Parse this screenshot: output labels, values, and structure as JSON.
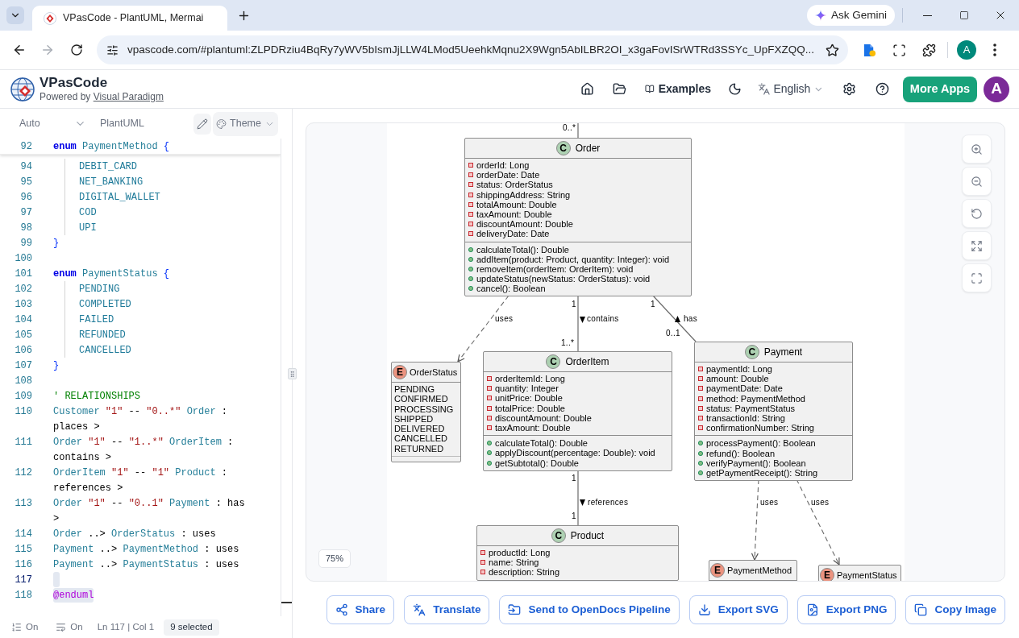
{
  "browser": {
    "tab_title": "VPasCode - PlantUML, Mermai",
    "gemini_button": "Ask Gemini",
    "address": "vpascode.com/#plantuml:ZLPDRziu4BqRy7yWV5bIsmJjLLW4LMod5UeehkMqnu2X9Wgn5AbILBR2OI_x3gaFovISrWTRd3SSYc_UpFXZQQ...",
    "profile_initial": "A"
  },
  "header": {
    "app_name": "VPasCode",
    "tagline": "Powered by",
    "tagline_link": "Visual Paradigm",
    "examples": "Examples",
    "language": "English",
    "more_apps": "More Apps",
    "avatar_initial": "A"
  },
  "editor": {
    "mode": "Auto",
    "language": "PlantUML",
    "theme_button": "Theme",
    "sticky_line": {
      "number": "92",
      "selected": false,
      "active": false,
      "tokens": [
        {
          "kind": "keyword",
          "text": "enum "
        },
        {
          "kind": "name",
          "text": "PaymentMethod "
        },
        {
          "kind": "brace",
          "text": "{"
        }
      ],
      "children": [
        {
          "number": "94",
          "selected": false,
          "active": false,
          "tokens": [
            {
              "kind": "constant",
              "text": "DEBIT_CARD"
            }
          ]
        },
        {
          "number": "95",
          "selected": false,
          "active": false,
          "tokens": [
            {
              "kind": "constant",
              "text": "NET_BANKING"
            }
          ]
        },
        {
          "number": "96",
          "selected": false,
          "active": false,
          "tokens": [
            {
              "kind": "constant",
              "text": "DIGITAL_WALLET"
            }
          ]
        },
        {
          "number": "97",
          "selected": false,
          "active": false,
          "tokens": [
            {
              "kind": "constant",
              "text": "COD"
            }
          ]
        },
        {
          "number": "98",
          "selected": false,
          "active": false,
          "tokens": [
            {
              "kind": "constant",
              "text": "UPI"
            }
          ]
        }
      ]
    },
    "lines": [
      {
        "number": "99",
        "selected": false,
        "active": false,
        "tokens": [
          {
            "kind": "brace",
            "text": "}"
          }
        ]
      },
      {
        "number": "100",
        "selected": false,
        "active": false
      },
      {
        "number": "101",
        "selected": false,
        "active": false,
        "tokens": [
          {
            "kind": "keyword",
            "text": "enum "
          },
          {
            "kind": "name",
            "text": "PaymentStatus "
          },
          {
            "kind": "brace",
            "text": "{"
          }
        ],
        "children": [
          {
            "number": "102",
            "selected": false,
            "active": false,
            "tokens": [
              {
                "kind": "constant",
                "text": "PENDING"
              }
            ]
          },
          {
            "number": "103",
            "selected": false,
            "active": false,
            "tokens": [
              {
                "kind": "constant",
                "text": "COMPLETED"
              }
            ]
          },
          {
            "number": "104",
            "selected": false,
            "active": false,
            "tokens": [
              {
                "kind": "constant",
                "text": "FAILED"
              }
            ]
          },
          {
            "number": "105",
            "selected": false,
            "active": false,
            "tokens": [
              {
                "kind": "constant",
                "text": "REFUNDED"
              }
            ]
          },
          {
            "number": "106",
            "selected": false,
            "active": false,
            "tokens": [
              {
                "kind": "constant",
                "text": "CANCELLED"
              }
            ]
          }
        ]
      },
      {
        "number": "107",
        "selected": false,
        "active": false,
        "tokens": [
          {
            "kind": "brace",
            "text": "}"
          }
        ]
      },
      {
        "number": "108",
        "selected": false,
        "active": false
      },
      {
        "number": "109",
        "selected": false,
        "active": false,
        "tokens": [
          {
            "kind": "comment",
            "text": "' RELATIONSHIPS"
          }
        ]
      },
      {
        "number": "110",
        "selected": false,
        "active": false,
        "tokens": [
          {
            "kind": "name",
            "text": "Customer "
          },
          {
            "kind": "string",
            "text": "\"1\""
          },
          {
            "kind": "plain",
            "text": " -- "
          },
          {
            "kind": "string",
            "text": "\"0..*\""
          },
          {
            "kind": "name",
            "text": " Order"
          },
          {
            "kind": "plain",
            "text": " :"
          }
        ],
        "continuation": [
          {
            "kind": "plain",
            "text": "places >"
          }
        ]
      },
      {
        "number": "111",
        "selected": false,
        "active": false,
        "tokens": [
          {
            "kind": "name",
            "text": "Order "
          },
          {
            "kind": "string",
            "text": "\"1\""
          },
          {
            "kind": "plain",
            "text": " -- "
          },
          {
            "kind": "string",
            "text": "\"1..*\""
          },
          {
            "kind": "name",
            "text": " OrderItem"
          },
          {
            "kind": "plain",
            "text": " :"
          }
        ],
        "continuation": [
          {
            "kind": "plain",
            "text": "contains >"
          }
        ]
      },
      {
        "number": "112",
        "selected": false,
        "active": false,
        "tokens": [
          {
            "kind": "name",
            "text": "OrderItem "
          },
          {
            "kind": "string",
            "text": "\"1\""
          },
          {
            "kind": "plain",
            "text": " -- "
          },
          {
            "kind": "string",
            "text": "\"1\""
          },
          {
            "kind": "name",
            "text": " Product"
          },
          {
            "kind": "plain",
            "text": " :"
          }
        ],
        "continuation": [
          {
            "kind": "plain",
            "text": "references >"
          }
        ]
      },
      {
        "number": "113",
        "selected": false,
        "active": false,
        "tokens": [
          {
            "kind": "name",
            "text": "Order "
          },
          {
            "kind": "string",
            "text": "\"1\""
          },
          {
            "kind": "plain",
            "text": " -- "
          },
          {
            "kind": "string",
            "text": "\"0..1\""
          },
          {
            "kind": "name",
            "text": " Payment"
          },
          {
            "kind": "plain",
            "text": " : has"
          }
        ],
        "continuation": [
          {
            "kind": "plain",
            "text": ">"
          }
        ]
      },
      {
        "number": "114",
        "selected": false,
        "active": false,
        "tokens": [
          {
            "kind": "name",
            "text": "Order"
          },
          {
            "kind": "plain",
            "text": " ..> "
          },
          {
            "kind": "name",
            "text": "OrderStatus"
          },
          {
            "kind": "plain",
            "text": " : uses"
          }
        ]
      },
      {
        "number": "115",
        "selected": false,
        "active": false,
        "tokens": [
          {
            "kind": "name",
            "text": "Payment"
          },
          {
            "kind": "plain",
            "text": " ..> "
          },
          {
            "kind": "name",
            "text": "PaymentMethod"
          },
          {
            "kind": "plain",
            "text": " : uses"
          }
        ]
      },
      {
        "number": "116",
        "selected": false,
        "active": false,
        "tokens": [
          {
            "kind": "name",
            "text": "Payment"
          },
          {
            "kind": "plain",
            "text": " ..> "
          },
          {
            "kind": "name",
            "text": "PaymentStatus"
          },
          {
            "kind": "plain",
            "text": " : uses"
          }
        ]
      },
      {
        "number": "117",
        "selected": true,
        "active": true
      },
      {
        "number": "118",
        "selected": true,
        "active": false,
        "tokens": [
          {
            "kind": "directive",
            "text": "@enduml"
          }
        ]
      }
    ],
    "status": {
      "line_numbers": "On",
      "word_wrap": "On",
      "position": "Ln 117 | Col 1",
      "selection": "9 selected"
    }
  },
  "diagram": {
    "classes": [
      {
        "kind": "class",
        "badge": "C",
        "name": "Order",
        "attributes": [
          {
            "public": false,
            "text": "orderId: Long"
          },
          {
            "public": false,
            "text": "orderDate: Date"
          },
          {
            "public": false,
            "text": "status: OrderStatus"
          },
          {
            "public": false,
            "text": "shippingAddress: String"
          },
          {
            "public": false,
            "text": "totalAmount: Double"
          },
          {
            "public": false,
            "text": "taxAmount: Double"
          },
          {
            "public": false,
            "text": "discountAmount: Double"
          },
          {
            "public": false,
            "text": "deliveryDate: Date"
          }
        ],
        "methods": [
          {
            "public": true,
            "text": "calculateTotal(): Double"
          },
          {
            "public": true,
            "text": "addItem(product: Product, quantity: Integer): void"
          },
          {
            "public": true,
            "text": "removeItem(orderItem: OrderItem): void"
          },
          {
            "public": true,
            "text": "updateStatus(newStatus: OrderStatus): void"
          },
          {
            "public": true,
            "text": "cancel(): Boolean"
          }
        ]
      },
      {
        "kind": "enum",
        "badge": "E",
        "name": "OrderStatus",
        "values": [
          "PENDING",
          "CONFIRMED",
          "PROCESSING",
          "SHIPPED",
          "DELIVERED",
          "CANCELLED",
          "RETURNED"
        ]
      },
      {
        "kind": "class",
        "badge": "C",
        "name": "OrderItem",
        "attributes": [
          {
            "public": false,
            "text": "orderItemId: Long"
          },
          {
            "public": false,
            "text": "quantity: Integer"
          },
          {
            "public": false,
            "text": "unitPrice: Double"
          },
          {
            "public": false,
            "text": "totalPrice: Double"
          },
          {
            "public": false,
            "text": "discountAmount: Double"
          },
          {
            "public": false,
            "text": "taxAmount: Double"
          }
        ],
        "methods": [
          {
            "public": true,
            "text": "calculateTotal(): Double"
          },
          {
            "public": true,
            "text": "applyDiscount(percentage: Double): void"
          },
          {
            "public": true,
            "text": "getSubtotal(): Double"
          }
        ]
      },
      {
        "kind": "class",
        "badge": "C",
        "name": "Payment",
        "attributes": [
          {
            "public": false,
            "text": "paymentId: Long"
          },
          {
            "public": false,
            "text": "amount: Double"
          },
          {
            "public": false,
            "text": "paymentDate: Date"
          },
          {
            "public": false,
            "text": "method: PaymentMethod"
          },
          {
            "public": false,
            "text": "status: PaymentStatus"
          },
          {
            "public": false,
            "text": "transactionId: String"
          },
          {
            "public": false,
            "text": "confirmationNumber: String"
          }
        ],
        "methods": [
          {
            "public": true,
            "text": "processPayment(): Boolean"
          },
          {
            "public": true,
            "text": "refund(): Boolean"
          },
          {
            "public": true,
            "text": "verifyPayment(): Boolean"
          },
          {
            "public": true,
            "text": "getPaymentReceipt(): String"
          }
        ]
      },
      {
        "kind": "class",
        "badge": "C",
        "name": "Product",
        "attributes": [
          {
            "public": false,
            "text": "productId: Long"
          },
          {
            "public": false,
            "text": "name: String"
          },
          {
            "public": false,
            "text": "description: String"
          }
        ]
      },
      {
        "kind": "enum",
        "badge": "E",
        "name": "PaymentMethod"
      },
      {
        "kind": "enum",
        "badge": "E",
        "name": "PaymentStatus"
      }
    ],
    "relations": [
      {
        "kind": "association",
        "target_multiplicity": "0..*"
      },
      {
        "kind": "dependency",
        "label": "uses"
      },
      {
        "kind": "association",
        "source_multiplicity": "1",
        "target_multiplicity": "1..*",
        "label": "contains",
        "reading_arrow_up": false
      },
      {
        "kind": "association",
        "source_multiplicity": "1",
        "target_multiplicity": "0..1",
        "label": "has",
        "reading_arrow_up": true
      },
      {
        "kind": "association",
        "source_multiplicity": "1",
        "target_multiplicity": "1",
        "label": "references",
        "reading_arrow_up": false
      },
      {
        "kind": "dependency",
        "label": "uses"
      },
      {
        "kind": "dependency",
        "label": "uses"
      }
    ]
  },
  "zoom_level": "75%",
  "actions": [
    "Share",
    "Translate",
    "Send to OpenDocs Pipeline",
    "Export SVG",
    "Export PNG",
    "Copy Image"
  ]
}
